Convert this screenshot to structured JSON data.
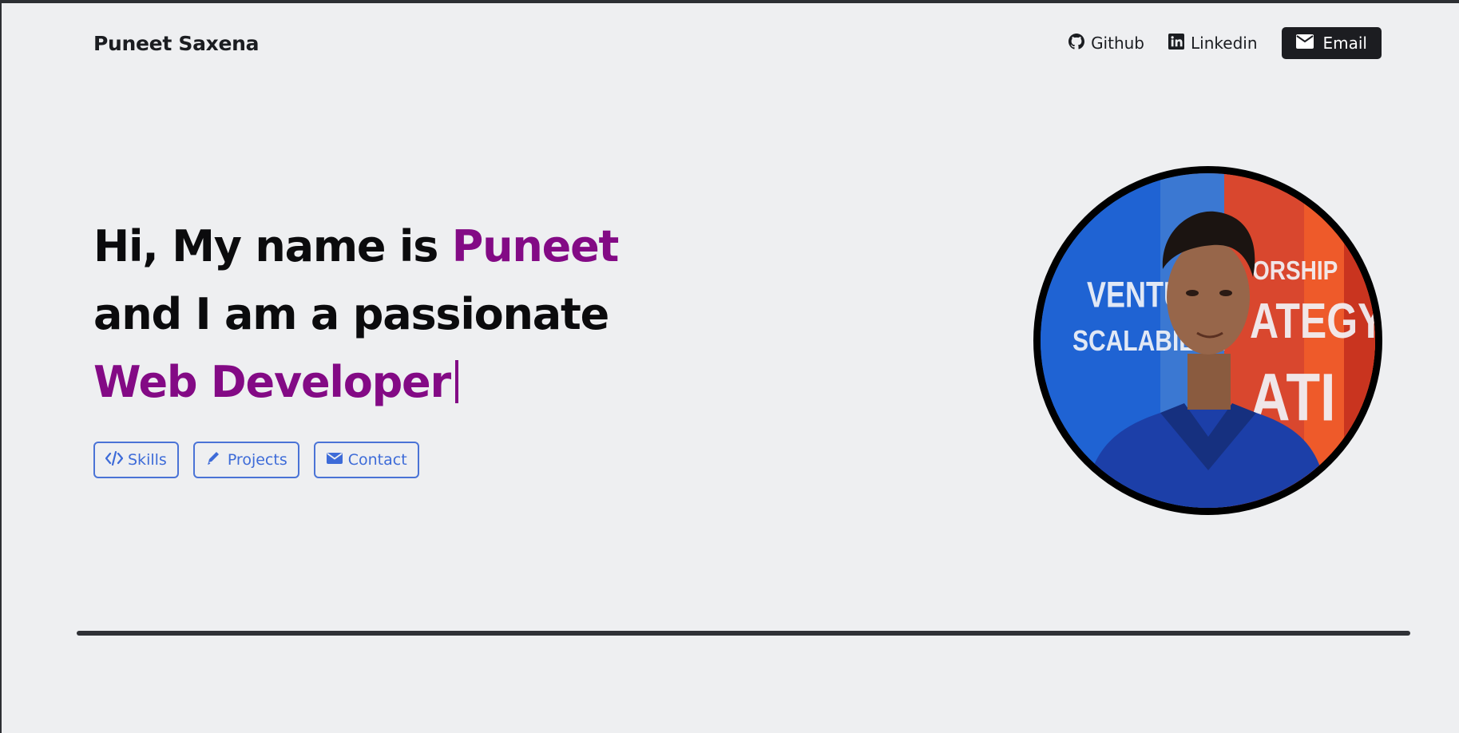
{
  "brand": "Puneet Saxena",
  "nav": {
    "github_label": "Github",
    "linkedin_label": "Linkedin",
    "email_label": "Email"
  },
  "hero": {
    "line1_prefix": "Hi, My name is ",
    "line1_name": "Puneet",
    "line2": "and I am a passionate",
    "line3_role": "Web Developer"
  },
  "actions": {
    "skills_label": "Skills",
    "projects_label": "Projects",
    "contact_label": "Contact"
  },
  "avatar": {
    "poster_words": [
      "VENTURE",
      "SCALABILITY",
      "ORSHIP",
      "ATEGY",
      "ATI"
    ]
  },
  "colors": {
    "accent": "#830a85",
    "button_blue": "#4a73d6",
    "dark": "#1c1d21",
    "background": "#eeeff1"
  },
  "icons": [
    "github-icon",
    "linkedin-icon",
    "envelope-icon",
    "code-icon",
    "pencil-icon"
  ]
}
